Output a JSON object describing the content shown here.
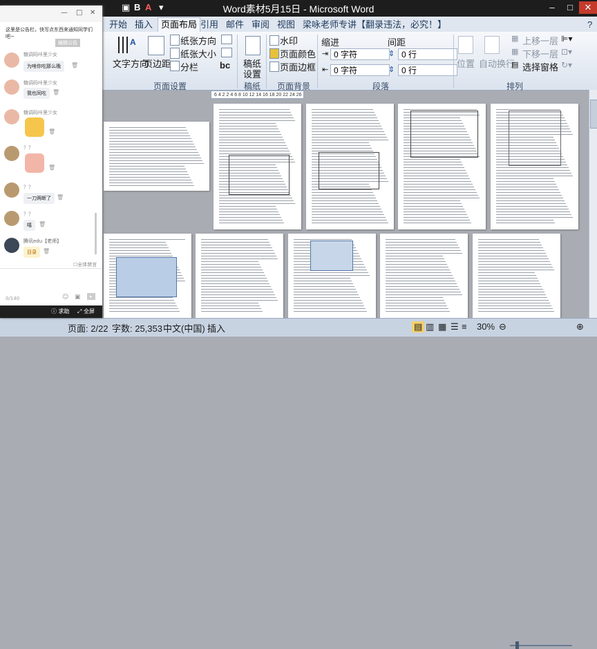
{
  "window": {
    "title": "Word素材5月15日 - Microsoft Word",
    "controls": [
      "–",
      "□",
      "✕"
    ]
  },
  "tabs": [
    "开始",
    "插入",
    "页面布局",
    "引用",
    "邮件",
    "审阅",
    "视图",
    "梁咏老师专讲【翻录违法，必究！】"
  ],
  "ribbon": {
    "page_setup": {
      "text_direction": "文字方向",
      "margins": "页边距",
      "orientation": "纸张方向",
      "size": "纸张大小",
      "columns": "分栏",
      "group": "页面设置"
    },
    "draft": {
      "label_1": "稿纸",
      "label_2": "设置",
      "group": "稿纸"
    },
    "page_bg": {
      "watermark": "水印",
      "page_color": "页面颜色",
      "page_border": "页面边框",
      "group": "页面背景"
    },
    "paragraph": {
      "indent": "缩进",
      "spacing": "间距",
      "indent_left": "0 字符",
      "indent_right": "0 字符",
      "space_before": "0 行",
      "space_after": "0 行",
      "group": "段落"
    },
    "arrange": {
      "position": "位置",
      "wrap": "自动换行",
      "bring_forward": "上移一层",
      "send_backward": "下移一层",
      "selection_pane": "选择窗格",
      "group": "排列"
    }
  },
  "ruler": "6  4  2     2  4  6  8  10  12  14  16  18  20  22  24  26  28  30  32  34  36  38  40  42  44  46  48",
  "status": {
    "page": "页面: 2/22",
    "words": "字数: 25,353",
    "lang": "中文(中国)",
    "mode": "插入",
    "zoom": "30%"
  },
  "chat": {
    "notice": "这里是公告栏，快写点东西来通知同学们吧~",
    "edit_notice": "编辑公告",
    "messages": [
      {
        "user": "糖调码咔里少女",
        "text": "为啥你吃那么晚"
      },
      {
        "user": "糖调码咔里少女",
        "text": "我也同吃"
      },
      {
        "user": "糖调码咔里少女",
        "text": ""
      },
      {
        "user": "？？",
        "text": ""
      },
      {
        "user": "？？",
        "text": "一刀两断了"
      },
      {
        "user": "？？",
        "text": "嘻"
      },
      {
        "user": "腾讯edu【老师】",
        "text": "目录"
      }
    ],
    "mute_all": "全体禁言",
    "counter": "0/140",
    "help": "求助",
    "fullscreen": "全屏"
  },
  "colors": {
    "titlebar": "#1d1d1d",
    "ribbon_tab": "#dfe6ef",
    "status_bar": "#c8d3e2",
    "workspace": "#a9acb3"
  }
}
